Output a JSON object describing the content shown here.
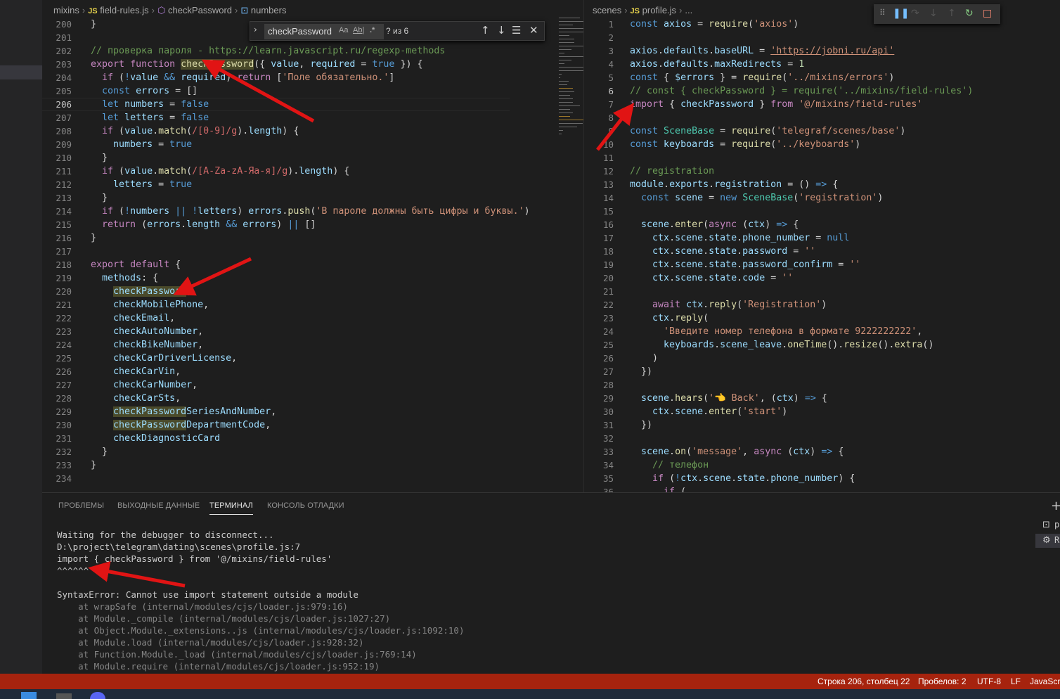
{
  "left_editor": {
    "breadcrumb": {
      "folder": "mixins",
      "js_badge": "JS",
      "file": "field-rules.js",
      "symbol1": "checkPassword",
      "symbol2_icon": "variable-icon",
      "symbol2": "numbers"
    },
    "find_widget": {
      "query": "checkPassword",
      "opt_case": "Aa",
      "opt_word": "Ab|",
      "opt_regex": ".*",
      "count": "? из 6"
    },
    "lines": [
      {
        "n": "200",
        "t": "}"
      },
      {
        "n": "201",
        "t": ""
      },
      {
        "n": "202",
        "t": "// проверка пароля - https://learn.javascript.ru/regexp-methods"
      },
      {
        "n": "203",
        "t": "export function checkPassword({ value, required = true }) {"
      },
      {
        "n": "204",
        "t": "  if (!value && required) return ['Поле обязательно.']"
      },
      {
        "n": "205",
        "t": "  const errors = []"
      },
      {
        "n": "206",
        "t": "  let numbers = false"
      },
      {
        "n": "207",
        "t": "  let letters = false"
      },
      {
        "n": "208",
        "t": "  if (value.match(/[0-9]/g).length) {"
      },
      {
        "n": "209",
        "t": "    numbers = true"
      },
      {
        "n": "210",
        "t": "  }"
      },
      {
        "n": "211",
        "t": "  if (value.match(/[A-Za-zА-Яа-я]/g).length) {"
      },
      {
        "n": "212",
        "t": "    letters = true"
      },
      {
        "n": "213",
        "t": "  }"
      },
      {
        "n": "214",
        "t": "  if (!numbers || !letters) errors.push('В пароле должны быть цифры и буквы.')"
      },
      {
        "n": "215",
        "t": "  return (errors.length && errors) || []"
      },
      {
        "n": "216",
        "t": "}"
      },
      {
        "n": "217",
        "t": ""
      },
      {
        "n": "218",
        "t": "export default {"
      },
      {
        "n": "219",
        "t": "  methods: {"
      },
      {
        "n": "220",
        "t": "    checkPassword,"
      },
      {
        "n": "221",
        "t": "    checkMobilePhone,"
      },
      {
        "n": "222",
        "t": "    checkEmail,"
      },
      {
        "n": "223",
        "t": "    checkAutoNumber,"
      },
      {
        "n": "224",
        "t": "    checkBikeNumber,"
      },
      {
        "n": "225",
        "t": "    checkCarDriverLicense,"
      },
      {
        "n": "226",
        "t": "    checkCarVin,"
      },
      {
        "n": "227",
        "t": "    checkCarNumber,"
      },
      {
        "n": "228",
        "t": "    checkCarSts,"
      },
      {
        "n": "229",
        "t": "    checkPasswordSeriesAndNumber,"
      },
      {
        "n": "230",
        "t": "    checkPasswordDepartmentCode,"
      },
      {
        "n": "231",
        "t": "    checkDiagnosticCard"
      },
      {
        "n": "232",
        "t": "  }"
      },
      {
        "n": "233",
        "t": "}"
      },
      {
        "n": "234",
        "t": ""
      }
    ]
  },
  "right_editor": {
    "breadcrumb": {
      "folder": "scenes",
      "js_badge": "JS",
      "file": "profile.js",
      "more": "..."
    },
    "lines": [
      {
        "n": "1",
        "t": "const axios = require('axios')"
      },
      {
        "n": "2",
        "t": ""
      },
      {
        "n": "3",
        "t": "axios.defaults.baseURL = 'https://jobni.ru/api'"
      },
      {
        "n": "4",
        "t": "axios.defaults.maxRedirects = 1"
      },
      {
        "n": "5",
        "t": "const { $errors } = require('../mixins/errors')"
      },
      {
        "n": "6",
        "t": "// const { checkPassword } = require('../mixins/field-rules')"
      },
      {
        "n": "7",
        "t": "import { checkPassword } from '@/mixins/field-rules'"
      },
      {
        "n": "8",
        "t": ""
      },
      {
        "n": "9",
        "t": "const SceneBase = require('telegraf/scenes/base')"
      },
      {
        "n": "10",
        "t": "const keyboards = require('../keyboards')"
      },
      {
        "n": "11",
        "t": ""
      },
      {
        "n": "12",
        "t": "// registration"
      },
      {
        "n": "13",
        "t": "module.exports.registration = () => {"
      },
      {
        "n": "14",
        "t": "  const scene = new SceneBase('registration')"
      },
      {
        "n": "15",
        "t": ""
      },
      {
        "n": "16",
        "t": "  scene.enter(async (ctx) => {"
      },
      {
        "n": "17",
        "t": "    ctx.scene.state.phone_number = null"
      },
      {
        "n": "18",
        "t": "    ctx.scene.state.password = ''"
      },
      {
        "n": "19",
        "t": "    ctx.scene.state.password_confirm = ''"
      },
      {
        "n": "20",
        "t": "    ctx.scene.state.code = ''"
      },
      {
        "n": "21",
        "t": ""
      },
      {
        "n": "22",
        "t": "    await ctx.reply('Registration')"
      },
      {
        "n": "23",
        "t": "    ctx.reply("
      },
      {
        "n": "24",
        "t": "      'Введите номер телефона в формате 9222222222',"
      },
      {
        "n": "25",
        "t": "      keyboards.scene_leave.oneTime().resize().extra()"
      },
      {
        "n": "26",
        "t": "    )"
      },
      {
        "n": "27",
        "t": "  })"
      },
      {
        "n": "28",
        "t": ""
      },
      {
        "n": "29",
        "t": "  scene.hears('👈 Back', (ctx) => {"
      },
      {
        "n": "30",
        "t": "    ctx.scene.enter('start')"
      },
      {
        "n": "31",
        "t": "  })"
      },
      {
        "n": "32",
        "t": ""
      },
      {
        "n": "33",
        "t": "  scene.on('message', async (ctx) => {"
      },
      {
        "n": "34",
        "t": "    // телефон"
      },
      {
        "n": "35",
        "t": "    if (!ctx.scene.state.phone_number) {"
      },
      {
        "n": "36",
        "t": "      if ("
      }
    ]
  },
  "panel": {
    "tabs": [
      "ПРОБЛЕМЫ",
      "ВЫХОДНЫЕ ДАННЫЕ",
      "ТЕРМИНАЛ",
      "КОНСОЛЬ ОТЛАДКИ"
    ],
    "active_tab": "ТЕРМИНАЛ",
    "terminal": [
      "Waiting for the debugger to disconnect...",
      "D:\\project\\telegram\\dating\\scenes\\profile.js:7",
      "import { checkPassword } from '@/mixins/field-rules'",
      "^^^^^^",
      "",
      "SyntaxError: Cannot use import statement outside a module",
      "    at wrapSafe (internal/modules/cjs/loader.js:979:16)",
      "    at Module._compile (internal/modules/cjs/loader.js:1027:27)",
      "    at Object.Module._extensions..js (internal/modules/cjs/loader.js:1092:10)",
      "    at Module.load (internal/modules/cjs/loader.js:928:32)",
      "    at Function.Module._load (internal/modules/cjs/loader.js:769:14)",
      "    at Module.require (internal/modules/cjs/loader.js:952:19)"
    ],
    "side_labels": [
      "p",
      "R"
    ]
  },
  "status_bar": {
    "position": "Строка 206, столбец 22",
    "spaces": "Пробелов: 2",
    "encoding": "UTF-8",
    "eol": "LF",
    "language": "JavaScri"
  },
  "colors": {
    "status_bar": "#a6230e",
    "annotation_arrow": "#e11414",
    "editor_bg": "#1e1e1e"
  }
}
